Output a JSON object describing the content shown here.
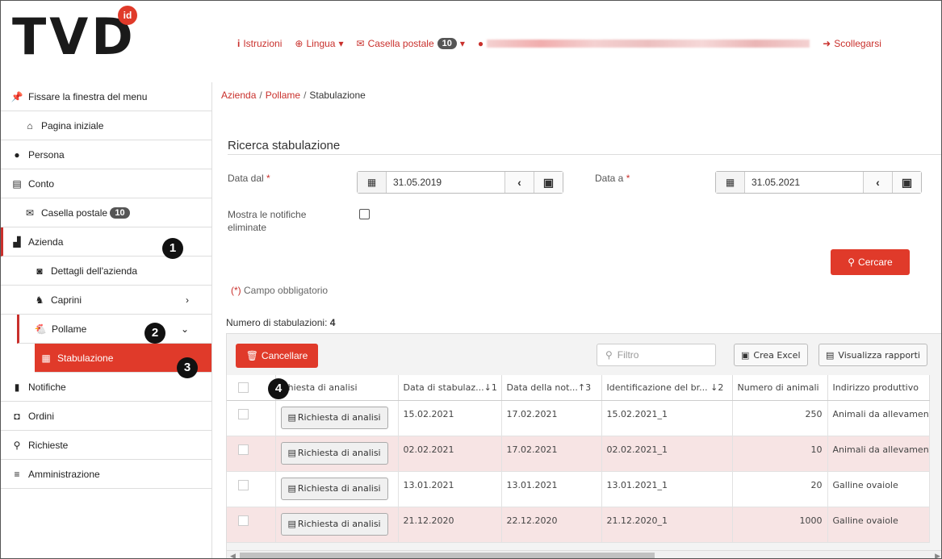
{
  "header": {
    "logo": "TVD",
    "logo_badge": "id",
    "nav": {
      "instructions": "Istruzioni",
      "language": "Lingua",
      "mailbox": "Casella postale",
      "mailbox_count": "10",
      "logout": "Scollegarsi"
    }
  },
  "sidebar": {
    "pin": "Fissare la finestra del menu",
    "home": "Pagina iniziale",
    "person": "Persona",
    "account": "Conto",
    "mailbox": "Casella postale",
    "mailbox_count": "10",
    "company": "Azienda",
    "company_details": "Dettagli dell'azienda",
    "goats": "Caprini",
    "poultry": "Pollame",
    "housing": "Stabulazione",
    "notifications": "Notifiche",
    "orders": "Ordini",
    "requests": "Richieste",
    "admin": "Amministrazione"
  },
  "markers": [
    "1",
    "2",
    "3",
    "4"
  ],
  "breadcrumb": {
    "item1": "Azienda",
    "item2": "Pollame",
    "current": "Stabulazione"
  },
  "search": {
    "title": "Ricerca stabulazione",
    "date_from_label": "Data dal",
    "date_from": "31.05.2019",
    "date_to_label": "Data a",
    "date_to": "31.05.2021",
    "required_mark": "*",
    "show_deleted_label": "Mostra le notifiche eliminate",
    "search_button": "Cercare",
    "required_hint_mark": "(*)",
    "required_hint": "Campo obbligatorio"
  },
  "results": {
    "count_label": "Numero di stabulazioni:",
    "count": "4",
    "delete_button": "Cancellare",
    "filter_placeholder": "Filtro",
    "excel_button": "Crea Excel",
    "reports_button": "Visualizza rapporti",
    "columns": [
      "ichiesta di analisi",
      "Data di stabulaz...↓1",
      "Data della not...↑3",
      "Identificazione del br... ↓2",
      "Numero di animali",
      "Indirizzo produttivo"
    ],
    "rows": [
      {
        "action": "Richiesta di analisi",
        "date_housing": "15.02.2021",
        "date_notice": "17.02.2021",
        "id": "15.02.2021_1",
        "animals": "250",
        "type": "Animali da allevament"
      },
      {
        "action": "Richiesta di analisi",
        "date_housing": "02.02.2021",
        "date_notice": "17.02.2021",
        "id": "02.02.2021_1",
        "animals": "10",
        "type": "Animali da allevament"
      },
      {
        "action": "Richiesta di analisi",
        "date_housing": "13.01.2021",
        "date_notice": "13.01.2021",
        "id": "13.01.2021_1",
        "animals": "20",
        "type": "Galline ovaiole"
      },
      {
        "action": "Richiesta di analisi",
        "date_housing": "21.12.2020",
        "date_notice": "22.12.2020",
        "id": "21.12.2020_1",
        "animals": "1000",
        "type": "Galline ovaiole"
      }
    ]
  },
  "colors": {
    "accent": "#e03a2a",
    "link": "#c9302c",
    "row_alt": "#f7e4e4"
  }
}
